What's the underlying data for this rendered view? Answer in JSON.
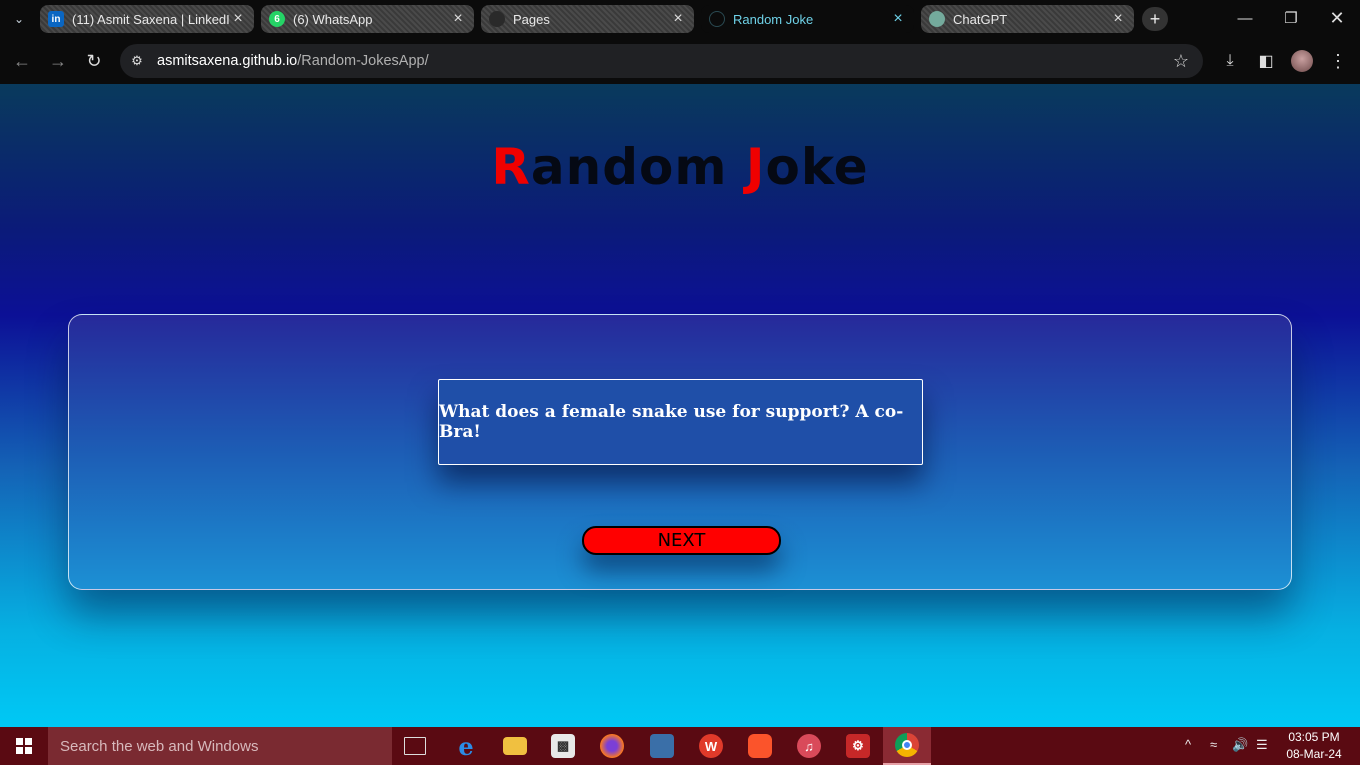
{
  "browser": {
    "tabs": [
      {
        "title": "(11) Asmit Saxena | LinkedIn",
        "favicon": "linkedin-icon",
        "color": "#0a66c2",
        "glyph": "in"
      },
      {
        "title": "(6) WhatsApp",
        "favicon": "whatsapp-icon",
        "color": "#25d366",
        "glyph": "6"
      },
      {
        "title": "Pages",
        "favicon": "github-icon",
        "color": "#2a2a2a",
        "glyph": ""
      },
      {
        "title": "Random Joke",
        "favicon": "globe-icon",
        "color": "#0b0b0b",
        "glyph": ""
      },
      {
        "title": "ChatGPT",
        "favicon": "chatgpt-icon",
        "color": "#74aa9c",
        "glyph": ""
      }
    ],
    "active_tab": 3,
    "url_host": "asmitsaxena.github.io",
    "url_path": "/Random-JokesApp/"
  },
  "page": {
    "title_first_initial": "R",
    "title_first_rest": "andom ",
    "title_second_initial": "J",
    "title_second_rest": "oke",
    "joke": "What does a female snake use for support? A co-Bra!",
    "next_label": "NEXT",
    "accent_color": "#ff0000"
  },
  "taskbar": {
    "search_placeholder": "Search the web and Windows",
    "time": "03:05 PM",
    "date": "08-Mar-24"
  }
}
